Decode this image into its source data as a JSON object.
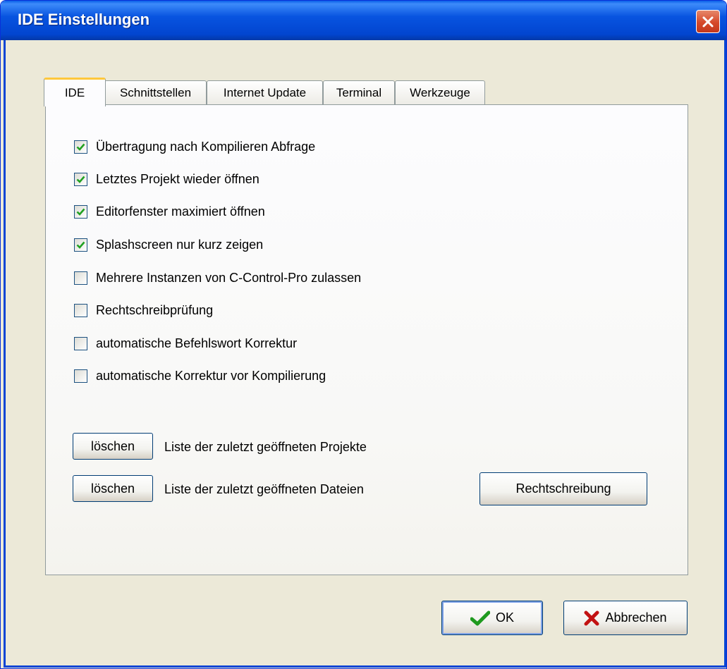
{
  "window": {
    "title": "IDE Einstellungen",
    "close_label": "close"
  },
  "tabs": [
    {
      "label": "IDE",
      "active": true
    },
    {
      "label": "Schnittstellen",
      "active": false
    },
    {
      "label": "Internet Update",
      "active": false
    },
    {
      "label": "Terminal",
      "active": false
    },
    {
      "label": "Werkzeuge",
      "active": false
    }
  ],
  "options": [
    {
      "label": "Übertragung nach Kompilieren Abfrage",
      "checked": true
    },
    {
      "label": "Letztes Projekt wieder öffnen",
      "checked": true
    },
    {
      "label": "Editorfenster maximiert öffnen",
      "checked": true
    },
    {
      "label": "Splashscreen nur kurz zeigen",
      "checked": true
    },
    {
      "label": "Mehrere Instanzen von C-Control-Pro zulassen",
      "checked": false
    },
    {
      "label": "Rechtschreibprüfung",
      "checked": false
    },
    {
      "label": "automatische Befehlswort Korrektur",
      "checked": false
    },
    {
      "label": "automatische Korrektur vor Kompilierung",
      "checked": false
    }
  ],
  "clear_actions": {
    "projects": {
      "button": "löschen",
      "label": "Liste der zuletzt geöffneten Projekte"
    },
    "files": {
      "button": "löschen",
      "label": "Liste der zuletzt geöffneten Dateien"
    }
  },
  "spelling_button": "Rechtschreibung",
  "footer": {
    "ok": "OK",
    "cancel": "Abbrechen"
  },
  "colors": {
    "title_bar": "#0854e0",
    "check_mark": "#21a121",
    "close_button": "#d6492a",
    "active_tab_highlight": "#ffc83c"
  },
  "icons": {
    "close": "close-icon",
    "ok": "checkmark-icon",
    "cancel": "x-icon"
  }
}
